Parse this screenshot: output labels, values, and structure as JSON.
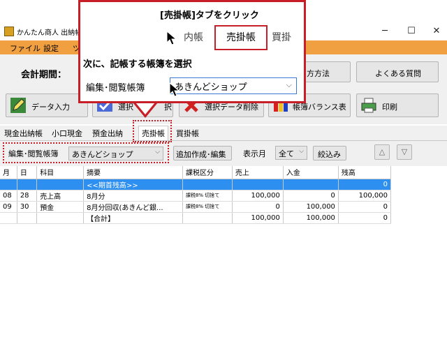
{
  "window": {
    "title": "かんたん商人 出納帳5 -",
    "minimize": "─",
    "maximize": "☐",
    "close": "✕"
  },
  "menu": [
    "ファイル",
    "設定",
    "ツ"
  ],
  "toolbar": {
    "period_label": "会計期間：",
    "pay_method": "方方法",
    "faq": "よくある質問",
    "data_entry": "データ入力",
    "select_partial": "選択",
    "select_partial2": "択",
    "delete_selected": "選択データ削除",
    "balance_table": "帳簿バランス表",
    "print": "印刷"
  },
  "tabs": [
    "現金出納帳",
    "小口現金",
    "預金出納",
    "売掛帳",
    "買掛帳"
  ],
  "filter": {
    "label": "編集･閲覧帳簿",
    "ledger_value": "あきんどショップ",
    "add_edit": "追加作成･編集",
    "month_label": "表示月",
    "month_value": "全て",
    "narrow": "絞込み",
    "up": "△",
    "down": "▽"
  },
  "grid": {
    "headers": [
      "月",
      "日",
      "科目",
      "摘要",
      "課税区分",
      "売上",
      "入金",
      "残高"
    ],
    "rows": [
      {
        "m": "",
        "d": "",
        "subject": "",
        "desc": "<<期首残高>>",
        "tax": "",
        "sales": "",
        "receipt": "",
        "balance": "0",
        "highlight": true
      },
      {
        "m": "08",
        "d": "28",
        "subject": "売上高",
        "desc": "8月分",
        "tax": "課税8% 切捨て",
        "sales": "100,000",
        "receipt": "0",
        "balance": "100,000",
        "highlight": false
      },
      {
        "m": "09",
        "d": "30",
        "subject": "預金",
        "desc": "8月分回収(あきんど銀...",
        "tax": "課税8% 切捨て",
        "sales": "0",
        "receipt": "100,000",
        "balance": "0",
        "highlight": false
      },
      {
        "m": "",
        "d": "",
        "subject": "",
        "desc": "【合計】",
        "tax": "",
        "sales": "100,000",
        "receipt": "100,000",
        "balance": "0",
        "highlight": false
      }
    ]
  },
  "callout": {
    "step1": "[売掛帳]タブをクリック",
    "tab_left": "内帳",
    "tab_active": "売掛帳",
    "tab_right": "買掛",
    "step2": "次に、記帳する帳簿を選択",
    "label": "編集･閲覧帳簿",
    "select_value": "あきんどショップ"
  },
  "colors": {
    "accent_red": "#c81e28",
    "menu_orange": "#f0a040",
    "row_blue": "#2d8ff0"
  }
}
